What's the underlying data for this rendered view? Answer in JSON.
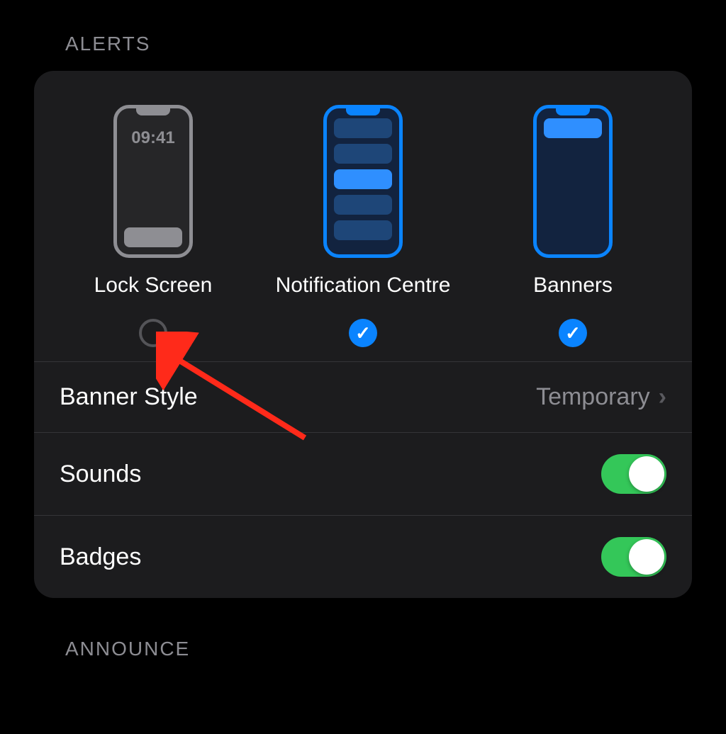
{
  "sections": {
    "alerts_header": "ALERTS",
    "announce_header": "ANNOUNCE"
  },
  "alerts": {
    "options": [
      {
        "label": "Lock Screen",
        "checked": false,
        "time": "09:41"
      },
      {
        "label": "Notification Centre",
        "checked": true
      },
      {
        "label": "Banners",
        "checked": true
      }
    ]
  },
  "rows": {
    "banner_style": {
      "label": "Banner Style",
      "value": "Temporary"
    },
    "sounds": {
      "label": "Sounds",
      "on": true
    },
    "badges": {
      "label": "Badges",
      "on": true
    }
  },
  "icons": {
    "check": "✓",
    "chevron": "›"
  }
}
